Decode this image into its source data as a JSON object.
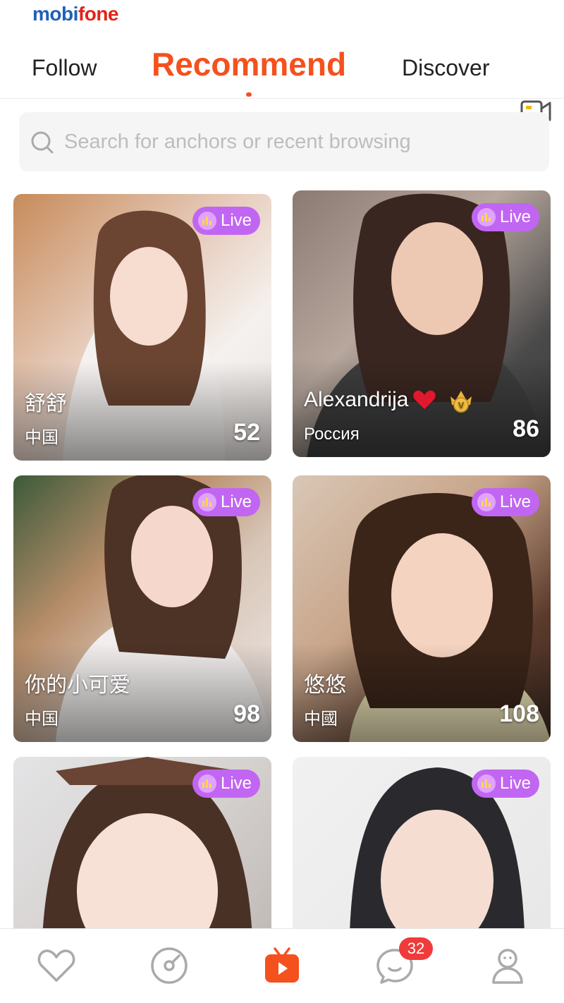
{
  "brand": {
    "part1": "mobi",
    "part2": "fone"
  },
  "tabs": [
    {
      "label": "Follow"
    },
    {
      "label": "Recommend",
      "active": true
    },
    {
      "label": "Discover"
    }
  ],
  "search": {
    "placeholder": "Search for anchors or recent browsing"
  },
  "colors": {
    "accent": "#f4511e",
    "live_badge": "#c166f2",
    "badge": "#f03b3b"
  },
  "cards": [
    {
      "live": "Live",
      "name": "舒舒",
      "country": "中国",
      "count": "52"
    },
    {
      "live": "Live",
      "name": "Alexandrija",
      "country": "Россия",
      "count": "86",
      "icons": [
        "heart-icon",
        "crown-vip-icon"
      ]
    },
    {
      "live": "Live",
      "name": "你的小可爱",
      "country": "中国",
      "count": "98"
    },
    {
      "live": "Live",
      "name": "悠悠",
      "country": "中國",
      "count": "108"
    },
    {
      "live": "Live",
      "name": "",
      "country": "",
      "count": ""
    },
    {
      "live": "Live",
      "name": "",
      "country": "",
      "count": ""
    }
  ],
  "nav": {
    "items": [
      "heart-icon",
      "compass-icon",
      "live-tv-icon",
      "chat-icon",
      "profile-icon"
    ],
    "messages_badge": "32"
  }
}
